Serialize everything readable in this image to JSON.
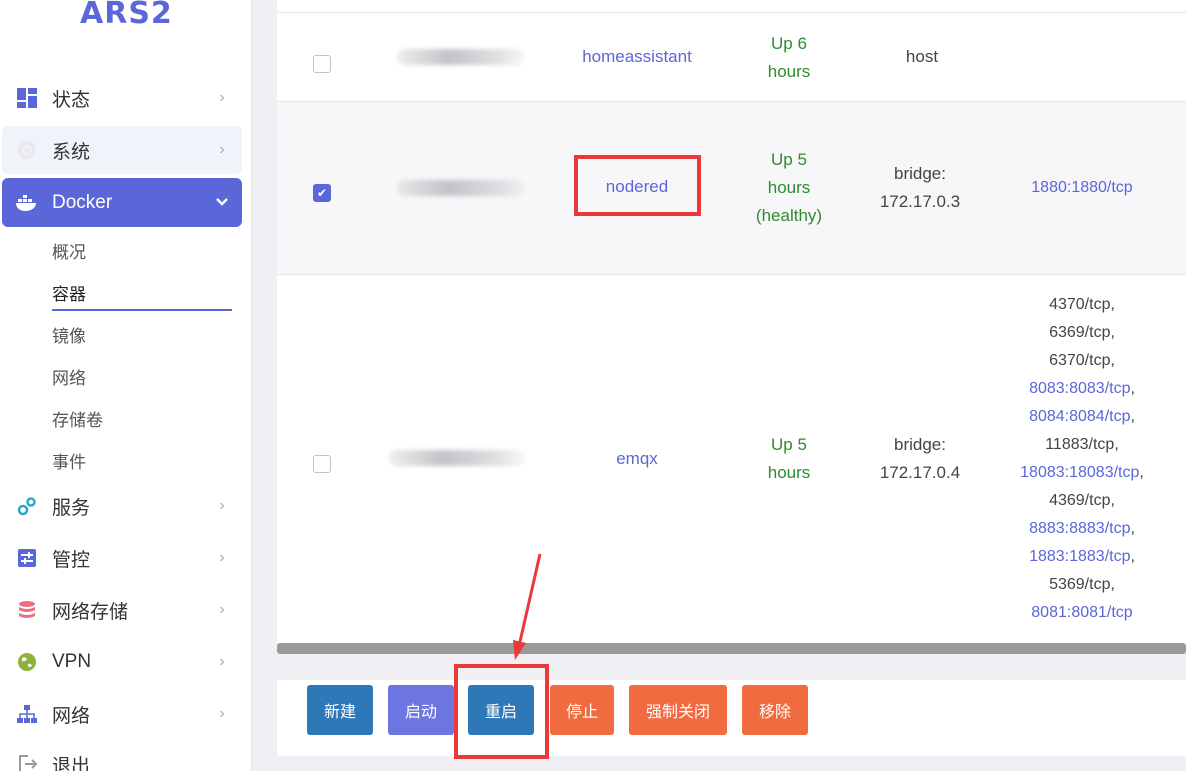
{
  "brand": "ARS2",
  "sidebar": {
    "items": [
      {
        "label": "状态",
        "icon": "dashboard-icon"
      },
      {
        "label": "系统",
        "icon": "gear-icon"
      },
      {
        "label": "Docker",
        "icon": "docker-icon"
      },
      {
        "label": "服务",
        "icon": "services-icon"
      },
      {
        "label": "管控",
        "icon": "sliders-icon"
      },
      {
        "label": "网络存储",
        "icon": "database-icon"
      },
      {
        "label": "VPN",
        "icon": "globe-icon"
      },
      {
        "label": "网络",
        "icon": "network-icon"
      },
      {
        "label": "退出",
        "icon": "logout-icon"
      }
    ],
    "docker_sub": [
      "概况",
      "容器",
      "镜像",
      "网络",
      "存储卷",
      "事件"
    ],
    "current_sub": "容器",
    "chevron_right": "›",
    "chevron_down": "⌄"
  },
  "containers": [
    {
      "name": "homeassistant",
      "status": [
        "Up 6",
        "hours"
      ],
      "network": [
        "host"
      ],
      "ports": []
    },
    {
      "name": "nodered",
      "status": [
        "Up 5",
        "hours",
        "(healthy)"
      ],
      "network": [
        "bridge:",
        "172.17.0.3"
      ],
      "ports": [
        {
          "text": "1880:1880/tcp",
          "link": true
        }
      ],
      "checked": true
    },
    {
      "name": "emqx",
      "status": [
        "Up 5",
        "hours"
      ],
      "network": [
        "bridge:",
        "172.17.0.4"
      ],
      "ports": [
        {
          "text": "4370/tcp,",
          "link": false
        },
        {
          "text": "6369/tcp,",
          "link": false
        },
        {
          "text": "6370/tcp,",
          "link": false
        },
        {
          "text": "8083:8083/tcp",
          "link": true,
          "suffix": ","
        },
        {
          "text": "8084:8084/tcp",
          "link": true,
          "suffix": ","
        },
        {
          "text": "11883/tcp,",
          "link": false
        },
        {
          "text": "18083:18083/tcp",
          "link": true,
          "suffix": ","
        },
        {
          "text": "4369/tcp,",
          "link": false
        },
        {
          "text": "8883:8883/tcp",
          "link": true,
          "suffix": ","
        },
        {
          "text": "1883:1883/tcp",
          "link": true,
          "suffix": ","
        },
        {
          "text": "5369/tcp,",
          "link": false
        },
        {
          "text": "8081:8081/tcp",
          "link": true,
          "suffix": ""
        }
      ]
    }
  ],
  "actions": {
    "new": "新建",
    "start": "启动",
    "restart": "重启",
    "stop": "停止",
    "kill": "强制关闭",
    "remove": "移除"
  },
  "colors": {
    "accent": "#5b67d8",
    "status_green": "#2e8b2e",
    "annotation_red": "#e83a3a",
    "button_blue": "#2e78b8",
    "button_orange": "#f26a3f"
  }
}
